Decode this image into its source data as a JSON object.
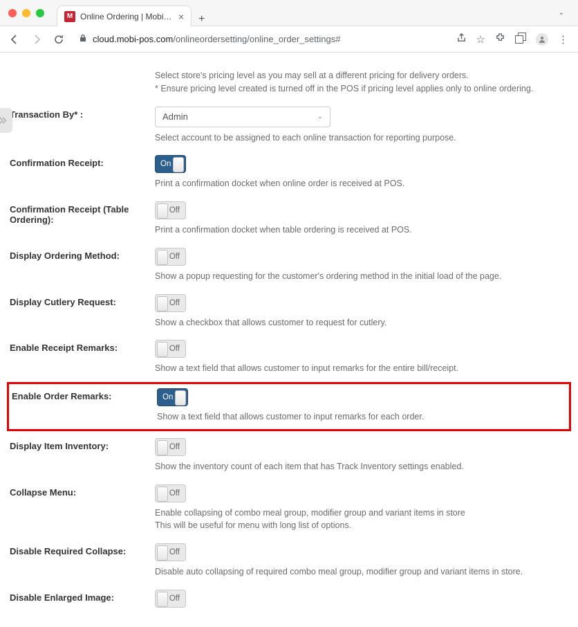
{
  "browser": {
    "tab_title": "Online Ordering | MobiPOS",
    "url_host": "cloud.mobi-pos.com",
    "url_path": "/onlineordersetting/online_order_settings#"
  },
  "pricing": {
    "help1": "Select store's pricing level as you may sell at a different pricing for delivery orders.",
    "help2": "* Ensure pricing level created is turned off in the POS if pricing level applies only to online ordering."
  },
  "settings": [
    {
      "label": "Transaction By* :",
      "type": "select",
      "value": "Admin",
      "help": "Select account to be assigned to each online transaction for reporting purpose."
    },
    {
      "label": "Confirmation Receipt:",
      "type": "toggle",
      "state": "on",
      "state_label": "On",
      "help": "Print a confirmation docket when online order is received at POS."
    },
    {
      "label": "Confirmation Receipt (Table Ordering):",
      "type": "toggle",
      "state": "off",
      "state_label": "Off",
      "help": "Print a confirmation docket when table ordering is received at POS."
    },
    {
      "label": "Display Ordering Method:",
      "type": "toggle",
      "state": "off",
      "state_label": "Off",
      "help": "Show a popup requesting for the customer's ordering method in the initial load of the page."
    },
    {
      "label": "Display Cutlery Request:",
      "type": "toggle",
      "state": "off",
      "state_label": "Off",
      "help": "Show a checkbox that allows customer to request for cutlery."
    },
    {
      "label": "Enable Receipt Remarks:",
      "type": "toggle",
      "state": "off",
      "state_label": "Off",
      "help": "Show a text field that allows customer to input remarks for the entire bill/receipt."
    },
    {
      "label": "Enable Order Remarks:",
      "type": "toggle",
      "state": "on",
      "state_label": "On",
      "help": "Show a text field that allows customer to input remarks for each order.",
      "highlight": true
    },
    {
      "label": "Display Item Inventory:",
      "type": "toggle",
      "state": "off",
      "state_label": "Off",
      "help": "Show the inventory count of each item that has Track Inventory settings enabled."
    },
    {
      "label": "Collapse Menu:",
      "type": "toggle",
      "state": "off",
      "state_label": "Off",
      "help": "Enable collapsing of combo meal group, modifier group and variant items in store",
      "help2": "This will be useful for menu with long list of options."
    },
    {
      "label": "Disable Required Collapse:",
      "type": "toggle",
      "state": "off",
      "state_label": "Off",
      "help": "Disable auto collapsing of required combo meal group, modifier group and variant items in store."
    },
    {
      "label": "Disable Enlarged Image:",
      "type": "toggle",
      "state": "off",
      "state_label": "Off"
    }
  ]
}
